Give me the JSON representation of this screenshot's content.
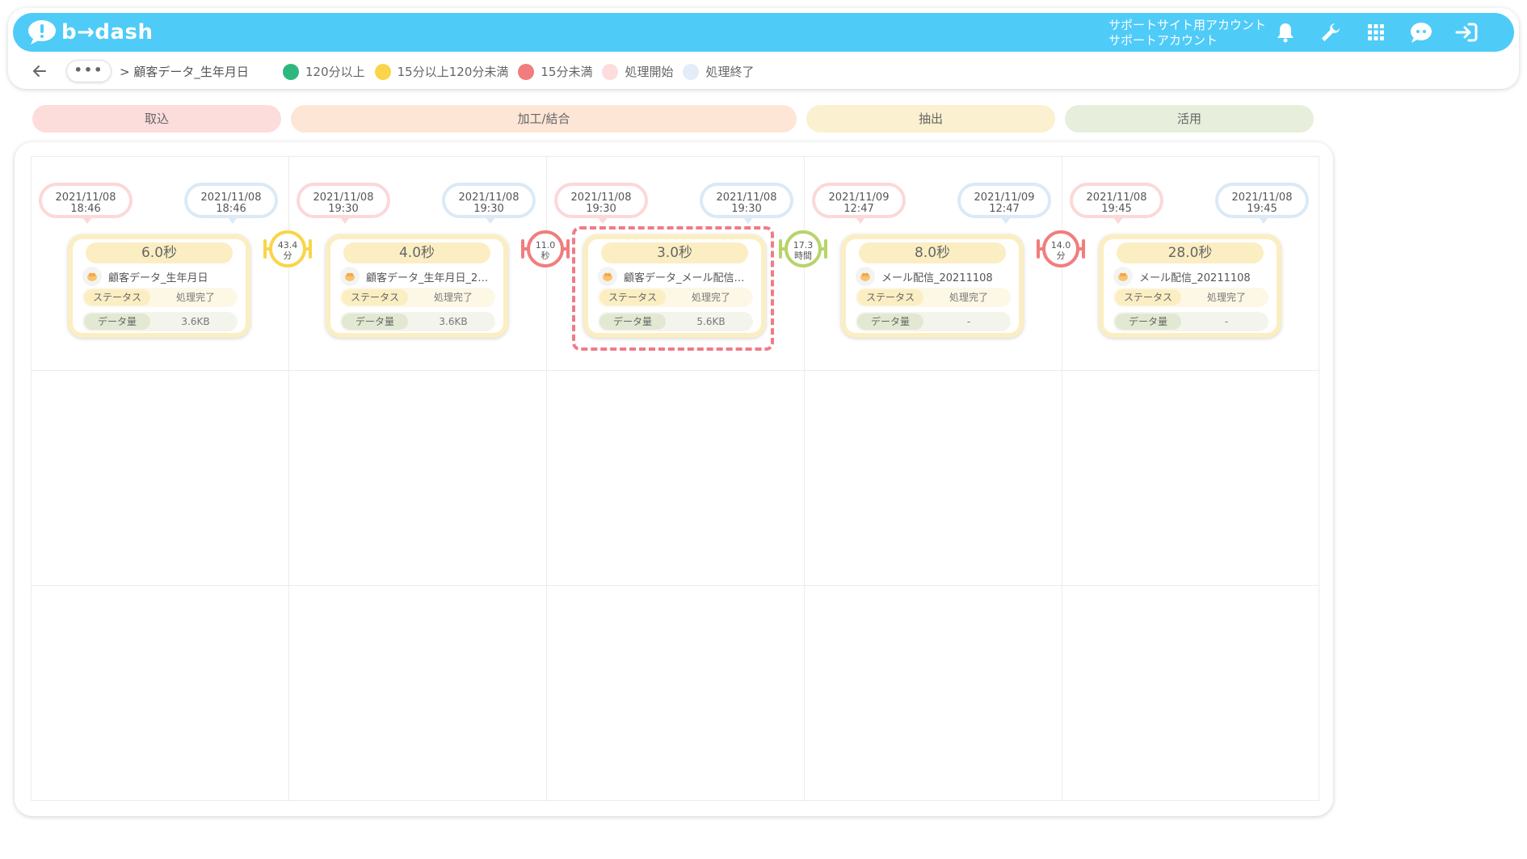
{
  "header": {
    "logo_text": "b→dash",
    "account_line1": "サポートサイト用アカウント",
    "account_line2": "サポートアカウント",
    "icons": [
      "bell-icon",
      "wrench-icon",
      "grid-icon",
      "help-bot-icon",
      "logout-icon"
    ],
    "accent_color": "#4fcbf8"
  },
  "breadcrumb": {
    "more_label": "•••",
    "current": "> 顧客データ_生年月日"
  },
  "legend": [
    {
      "label": "120分以上",
      "color": "#2eb87e"
    },
    {
      "label": "15分以上120分未満",
      "color": "#f9d54a"
    },
    {
      "label": "15分未満",
      "color": "#f17d7d"
    },
    {
      "label": "処理開始",
      "color": "#fcdcdc"
    },
    {
      "label": "処理終了",
      "color": "#e3edf8"
    }
  ],
  "phases": [
    {
      "label": "取込",
      "color": "#fddcdc"
    },
    {
      "label": "加工/結合",
      "color": "#fde6d6"
    },
    {
      "label": "抽出",
      "color": "#fbf0cf"
    },
    {
      "label": "活用",
      "color": "#e7eedb"
    }
  ],
  "jobs": [
    {
      "start_date": "2021/11/08",
      "start_time": "18:46",
      "end_date": "2021/11/08",
      "end_time": "18:46",
      "duration": "6.0秒",
      "name": "顧客データ_生年月日",
      "status_label": "ステータス",
      "status": "処理完了",
      "size_label": "データ量",
      "size": "3.6KB"
    },
    {
      "start_date": "2021/11/08",
      "start_time": "19:30",
      "end_date": "2021/11/08",
      "end_time": "19:30",
      "duration": "4.0秒",
      "name": "顧客データ_生年月日_2…",
      "status_label": "ステータス",
      "status": "処理完了",
      "size_label": "データ量",
      "size": "3.6KB"
    },
    {
      "start_date": "2021/11/08",
      "start_time": "19:30",
      "end_date": "2021/11/08",
      "end_time": "19:30",
      "duration": "3.0秒",
      "name": "顧客データ_メール配信…",
      "status_label": "ステータス",
      "status": "処理完了",
      "size_label": "データ量",
      "size": "5.6KB"
    },
    {
      "start_date": "2021/11/09",
      "start_time": "12:47",
      "end_date": "2021/11/09",
      "end_time": "12:47",
      "duration": "8.0秒",
      "name": "メール配信_20211108",
      "status_label": "ステータス",
      "status": "処理完了",
      "size_label": "データ量",
      "size": "-"
    },
    {
      "start_date": "2021/11/08",
      "start_time": "19:45",
      "end_date": "2021/11/08",
      "end_time": "19:45",
      "duration": "28.0秒",
      "name": "メール配信_20211108",
      "status_label": "ステータス",
      "status": "処理完了",
      "size_label": "データ量",
      "size": "-"
    }
  ],
  "connectors": [
    {
      "value": "43.4",
      "unit": "分",
      "color": "#f9d54a"
    },
    {
      "value": "11.0",
      "unit": "秒",
      "color": "#f17d7d"
    },
    {
      "value": "17.3",
      "unit": "時間",
      "color": "#b7d46a"
    },
    {
      "value": "14.0",
      "unit": "分",
      "color": "#f17d7d"
    }
  ]
}
